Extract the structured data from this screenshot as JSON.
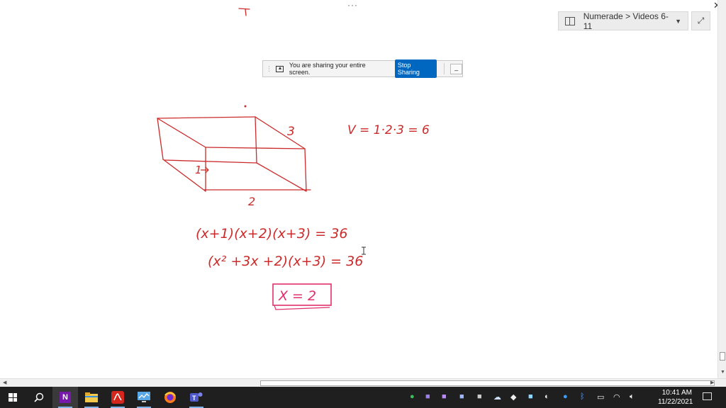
{
  "window": {
    "more_label": "···",
    "close_label": "✕"
  },
  "notebook_nav": {
    "breadcrumb": "Numerade > Videos 6-11",
    "caret": "▼",
    "expand_label": "⤢",
    "icon": "book-icon"
  },
  "share_bar": {
    "message": "You are sharing your entire screen.",
    "stop_label": "Stop Sharing",
    "minimize_label": "_",
    "icon": "share-screen-icon"
  },
  "handwriting": {
    "ink_color": "#cc2b2b",
    "box_color": "#e0306a",
    "box_label_height": "1",
    "box_label_depth": "3",
    "box_label_width": "2",
    "volume_eq": "V = 1·2·3 = 6",
    "eq1": "(x+1)(x+2)(x+3) = 36",
    "eq2": "(x² +3x +2)(x+3) = 36",
    "answer": "X = 2"
  },
  "taskbar": {
    "clock_time": "10:41 AM",
    "clock_date": "11/22/2021",
    "apps": [
      {
        "name": "start-icon"
      },
      {
        "name": "search-icon"
      },
      {
        "name": "onenote-icon",
        "label": "N"
      },
      {
        "name": "file-explorer-icon"
      },
      {
        "name": "acrobat-icon"
      },
      {
        "name": "task-manager-icon"
      },
      {
        "name": "firefox-icon"
      },
      {
        "name": "teams-icon"
      }
    ],
    "tray": [
      "sync-icon",
      "app-icon",
      "mic-icon",
      "app-icon",
      "app-icon",
      "onedrive-icon",
      "security-icon",
      "chat-icon",
      "skype-icon",
      "bluetooth-icon",
      "battery-icon",
      "wifi-icon",
      "volume-icon"
    ]
  },
  "colors": {
    "accent_blue": "#0067c0",
    "taskbar_bg": "#1f1f1f"
  }
}
